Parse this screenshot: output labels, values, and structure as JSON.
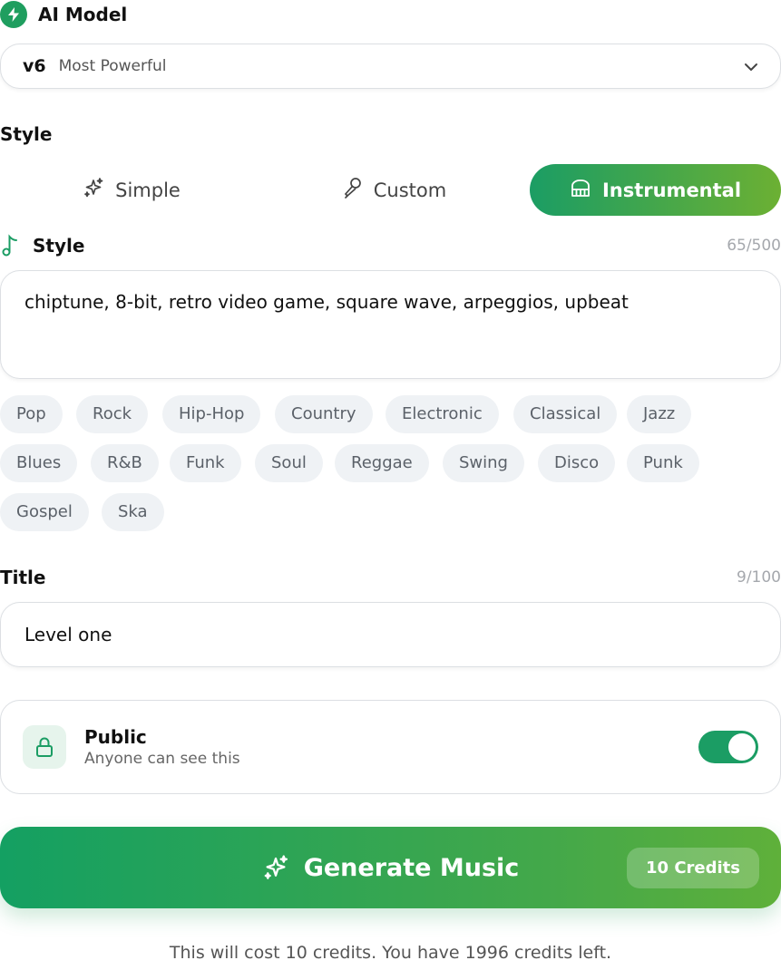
{
  "model": {
    "title": "AI Model",
    "version": "v6",
    "description": "Most Powerful"
  },
  "style_section": {
    "label": "Style"
  },
  "tabs": [
    {
      "label": "Simple",
      "icon": "sparkles-icon",
      "active": false
    },
    {
      "label": "Custom",
      "icon": "microphone-icon",
      "active": false
    },
    {
      "label": "Instrumental",
      "icon": "piano-icon",
      "active": true
    }
  ],
  "style_input": {
    "label": "Style",
    "counter": "65/500",
    "value": "chiptune, 8-bit, retro video game, square wave, arpeggios, upbeat"
  },
  "genres": [
    "Pop",
    "Rock",
    "Hip-Hop",
    "Country",
    "Electronic",
    "Classical",
    "Jazz",
    "Blues",
    "R&B",
    "Funk",
    "Soul",
    "Reggae",
    "Swing",
    "Disco",
    "Punk",
    "Gospel",
    "Ska"
  ],
  "title_input": {
    "label": "Title",
    "counter": "9/100",
    "value": "Level one"
  },
  "visibility": {
    "title": "Public",
    "subtitle": "Anyone can see this",
    "enabled": true
  },
  "generate": {
    "label": "Generate Music",
    "credits_badge": "10 Credits"
  },
  "cost_note": "This will cost 10 credits. You have 1996 credits left.",
  "colors": {
    "accent": "#1b9d64",
    "accent_end": "#6cb033"
  }
}
